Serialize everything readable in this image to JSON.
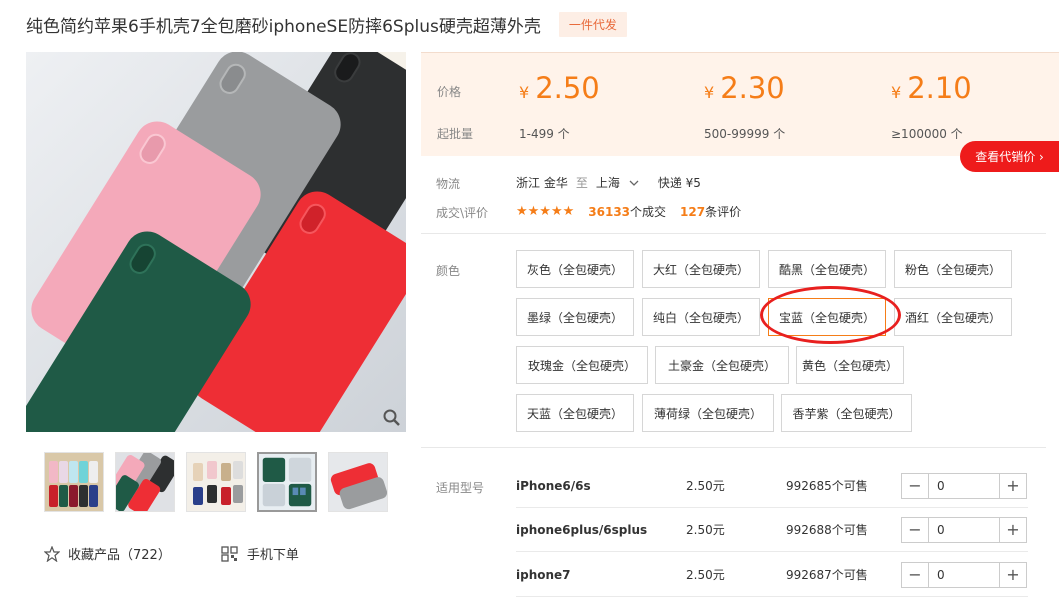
{
  "title": "纯色简约苹果6手机壳7全包磨砂iphoneSE防摔6Splus硬壳超薄外壳",
  "badge": "一件代发",
  "pricing": {
    "price_label": "价格",
    "batch_label": "起批量",
    "currency": "¥",
    "tiers": [
      {
        "price": "2.50",
        "range": "1-499 个"
      },
      {
        "price": "2.30",
        "range": "500-99999 个"
      },
      {
        "price": "2.10",
        "range": "≥100000 个"
      }
    ]
  },
  "agent_price_button": "查看代销价 ›",
  "logistics": {
    "label": "物流",
    "from": "浙江 金华",
    "to_word": "至",
    "to": "上海",
    "express": "快递 ¥5"
  },
  "deal": {
    "label": "成交\\评价",
    "stars": "★★★★★",
    "rating": 4.5,
    "sold_count": "36133",
    "sold_text": "个成交",
    "review_count": "127",
    "review_text": "条评价"
  },
  "colors": {
    "label": "颜色",
    "options": [
      "灰色（全包硬壳）",
      "大红（全包硬壳）",
      "酷黑（全包硬壳）",
      "粉色（全包硬壳）",
      "墨绿（全包硬壳）",
      "纯白（全包硬壳）",
      "宝蓝（全包硬壳）",
      "酒红（全包硬壳）",
      "玫瑰金（全包硬壳）",
      "土豪金（全包硬壳）",
      "黄色（全包硬壳）",
      "天蓝（全包硬壳）",
      "薄荷绿（全包硬壳）",
      "香芋紫（全包硬壳）"
    ],
    "selected": "宝蓝（全包硬壳）"
  },
  "models": {
    "label": "适用型号",
    "rows": [
      {
        "name": "iPhone6/6s",
        "price": "2.50元",
        "stock": "992685个可售",
        "qty": "0"
      },
      {
        "name": "iphone6plus/6splus",
        "price": "2.50元",
        "stock": "992688个可售",
        "qty": "0"
      },
      {
        "name": "iphone7",
        "price": "2.50元",
        "stock": "992687个可售",
        "qty": "0"
      }
    ]
  },
  "actions": {
    "favorite": "收藏产品（722）",
    "mobile_order": "手机下单"
  },
  "icons": {
    "zoom": "magnifier-icon",
    "star": "star-outline-icon",
    "qr": "qr-code-icon",
    "chevron": "chevron-down-icon"
  },
  "colors_hex": {
    "accent_orange": "#f57d18",
    "price_bg": "#fff3ea",
    "agent_red": "#ee1b1b",
    "annotation_red": "#e8201f"
  }
}
